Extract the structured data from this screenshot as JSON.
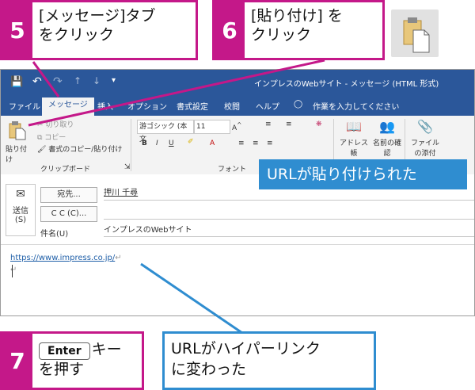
{
  "steps": {
    "s5": {
      "num": "5",
      "line1": "[メッセージ]タブ",
      "line2": "をクリック"
    },
    "s6": {
      "num": "6",
      "line1": "[貼り付け] を",
      "line2": "クリック"
    },
    "s7": {
      "num": "7",
      "key": "Enter",
      "after_key": "キー",
      "line2": "を押す"
    }
  },
  "callouts": {
    "pasted": "URLが貼り付けられた",
    "hyperlink_line1": "URLがハイパーリンク",
    "hyperlink_line2": "に変わった"
  },
  "window": {
    "title": "インプレスのWebサイト - メッセージ (HTML 形式)"
  },
  "ribbon_tabs": [
    "ファイル",
    "メッセージ",
    "挿入",
    "オプション",
    "書式設定",
    "校閲",
    "ヘルプ",
    "作業を入力してください"
  ],
  "clipboard_group": {
    "paste_label": "貼り付け",
    "cut": "切り取り",
    "copy": "コピー",
    "format_painter": "書式のコピー/貼り付け",
    "group_label": "クリップボード"
  },
  "font_group": {
    "font_name": "游ゴシック (本文",
    "font_size": "11",
    "group_label": "フォント"
  },
  "names_group": {
    "address_book": "アドレス帳",
    "check_names": "名前の確認"
  },
  "include_group": {
    "attach_file": "ファイルの添付"
  },
  "compose": {
    "send_label": "送信",
    "send_shortcut": "(S)",
    "to_button": "宛先...",
    "to_value": "押川 千尋",
    "cc_button": "C C (C)...",
    "subject_label": "件名(U)",
    "subject_value": "インプレスのWebサイト",
    "body_link": "https://www.impress.co.jp/",
    "return_mark": "↵"
  },
  "colors": {
    "magenta": "#c41889",
    "blue": "#2f8dd0",
    "outlook_blue": "#2b579a",
    "link": "#1f5fa8"
  }
}
